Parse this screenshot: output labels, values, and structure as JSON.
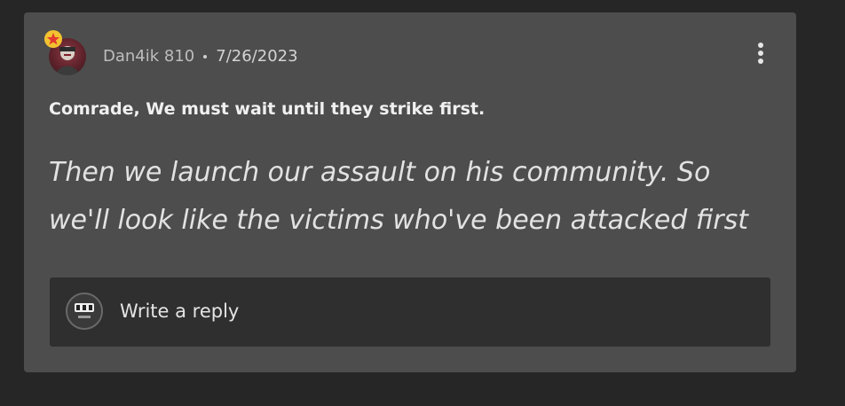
{
  "comment": {
    "author": "Dan4ik 810",
    "date": "7/26/2023",
    "title": "Comrade, We must wait until they strike first.",
    "body": "Then we launch our assault on his community. So we'll look like the victims who've been attacked first"
  },
  "reply": {
    "placeholder": "Write a reply"
  },
  "icons": {
    "author_avatar": "user-avatar-icon",
    "badge": "star-badge-icon",
    "more": "more-vertical-icon",
    "reply_avatar": "user-avatar-icon"
  },
  "colors": {
    "page_bg": "#262626",
    "card_bg": "#4d4d4d",
    "reply_bg": "#2f2f2f",
    "badge_star": "#e23a2e",
    "badge_bg": "#f2c230"
  }
}
